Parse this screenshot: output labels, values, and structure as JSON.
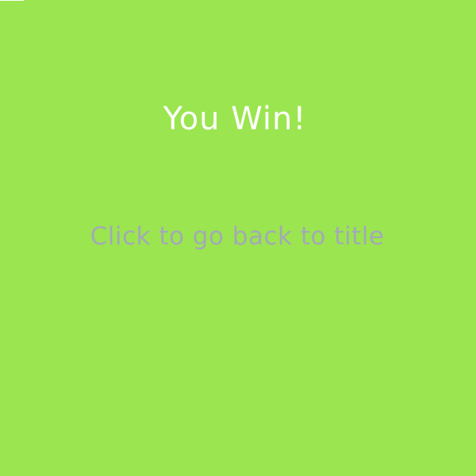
{
  "game": {
    "title": "You Win!",
    "prompt": "Click to go back to title"
  },
  "colors": {
    "background": "#9be550",
    "title": "#ffffff",
    "prompt": "#a2aab6"
  }
}
